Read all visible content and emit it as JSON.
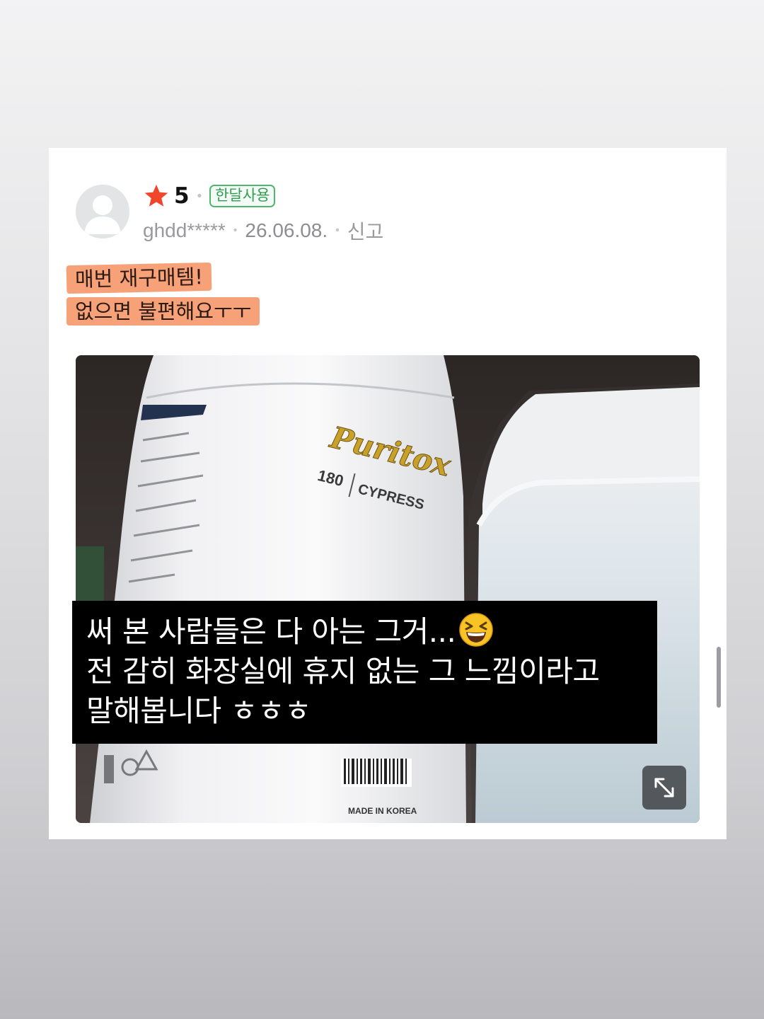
{
  "review": {
    "rating": "5",
    "badge": "한달사용",
    "username": "ghdd*****",
    "date": "26.06.08.",
    "report_label": "신고",
    "highlight_line1": "매번 재구매템!",
    "highlight_line2": "없으면 불편해요ㅜㅜ"
  },
  "photo": {
    "brand": "Puritox",
    "count": "180",
    "fragrance": "CYPRESS",
    "origin": "MADE IN KOREA"
  },
  "caption": {
    "line1": "써 본 사람들은 다 아는 그거...",
    "line2": "전 감히 화장실에 휴지 없는 그 느낌이라고",
    "line3": "말해봅니다 ㅎㅎㅎ"
  },
  "icons": {
    "star": "star-icon",
    "avatar": "user-avatar-icon",
    "emoji": "grinning-squinting-face-icon",
    "expand": "expand-arrows-icon"
  },
  "colors": {
    "star": "#f0462b",
    "badge_green": "#2f9d52",
    "highlight": "#f7a178"
  }
}
